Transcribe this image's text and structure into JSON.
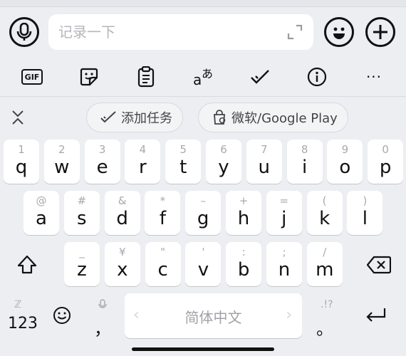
{
  "input": {
    "placeholder": "记录一下"
  },
  "suggestions": {
    "chip1": "添加任务",
    "chip2": "微软/Google Play"
  },
  "icons": {
    "mic": "microphone-icon",
    "emoji": "emoji-icon",
    "add": "plus-icon",
    "gif": "gif-icon",
    "sticker": "sticker-icon",
    "clipboard": "clipboard-icon",
    "translate": "translate-icon",
    "check": "check-icon",
    "info": "info-icon",
    "more": "more-icon"
  },
  "tools": {
    "gif": "GIF",
    "translate_a": "a",
    "translate_b": "あ",
    "more": "···"
  },
  "keyboard": {
    "row1": [
      {
        "main": "q",
        "sub": "1"
      },
      {
        "main": "w",
        "sub": "2"
      },
      {
        "main": "e",
        "sub": "3"
      },
      {
        "main": "r",
        "sub": "4"
      },
      {
        "main": "t",
        "sub": "5"
      },
      {
        "main": "y",
        "sub": "6"
      },
      {
        "main": "u",
        "sub": "7"
      },
      {
        "main": "i",
        "sub": "8"
      },
      {
        "main": "o",
        "sub": "9"
      },
      {
        "main": "p",
        "sub": "0"
      }
    ],
    "row2": [
      {
        "main": "a",
        "sub": "@"
      },
      {
        "main": "s",
        "sub": "#"
      },
      {
        "main": "d",
        "sub": "&"
      },
      {
        "main": "f",
        "sub": "*"
      },
      {
        "main": "g",
        "sub": "–"
      },
      {
        "main": "h",
        "sub": "+"
      },
      {
        "main": "j",
        "sub": "="
      },
      {
        "main": "k",
        "sub": "("
      },
      {
        "main": "l",
        "sub": ")"
      }
    ],
    "row3": [
      {
        "main": "z",
        "sub": "_"
      },
      {
        "main": "x",
        "sub": "¥"
      },
      {
        "main": "c",
        "sub": "\""
      },
      {
        "main": "v",
        "sub": "'"
      },
      {
        "main": "b",
        "sub": ":"
      },
      {
        "main": "n",
        "sub": ";"
      },
      {
        "main": "m",
        "sub": "/"
      }
    ],
    "num_key": "123",
    "comma": "，",
    "period": "。",
    "space_label": "简体中文",
    "space_left": "‹",
    "space_right": "›",
    "num_sub": "ℤ",
    "period_sub": ".!?"
  }
}
